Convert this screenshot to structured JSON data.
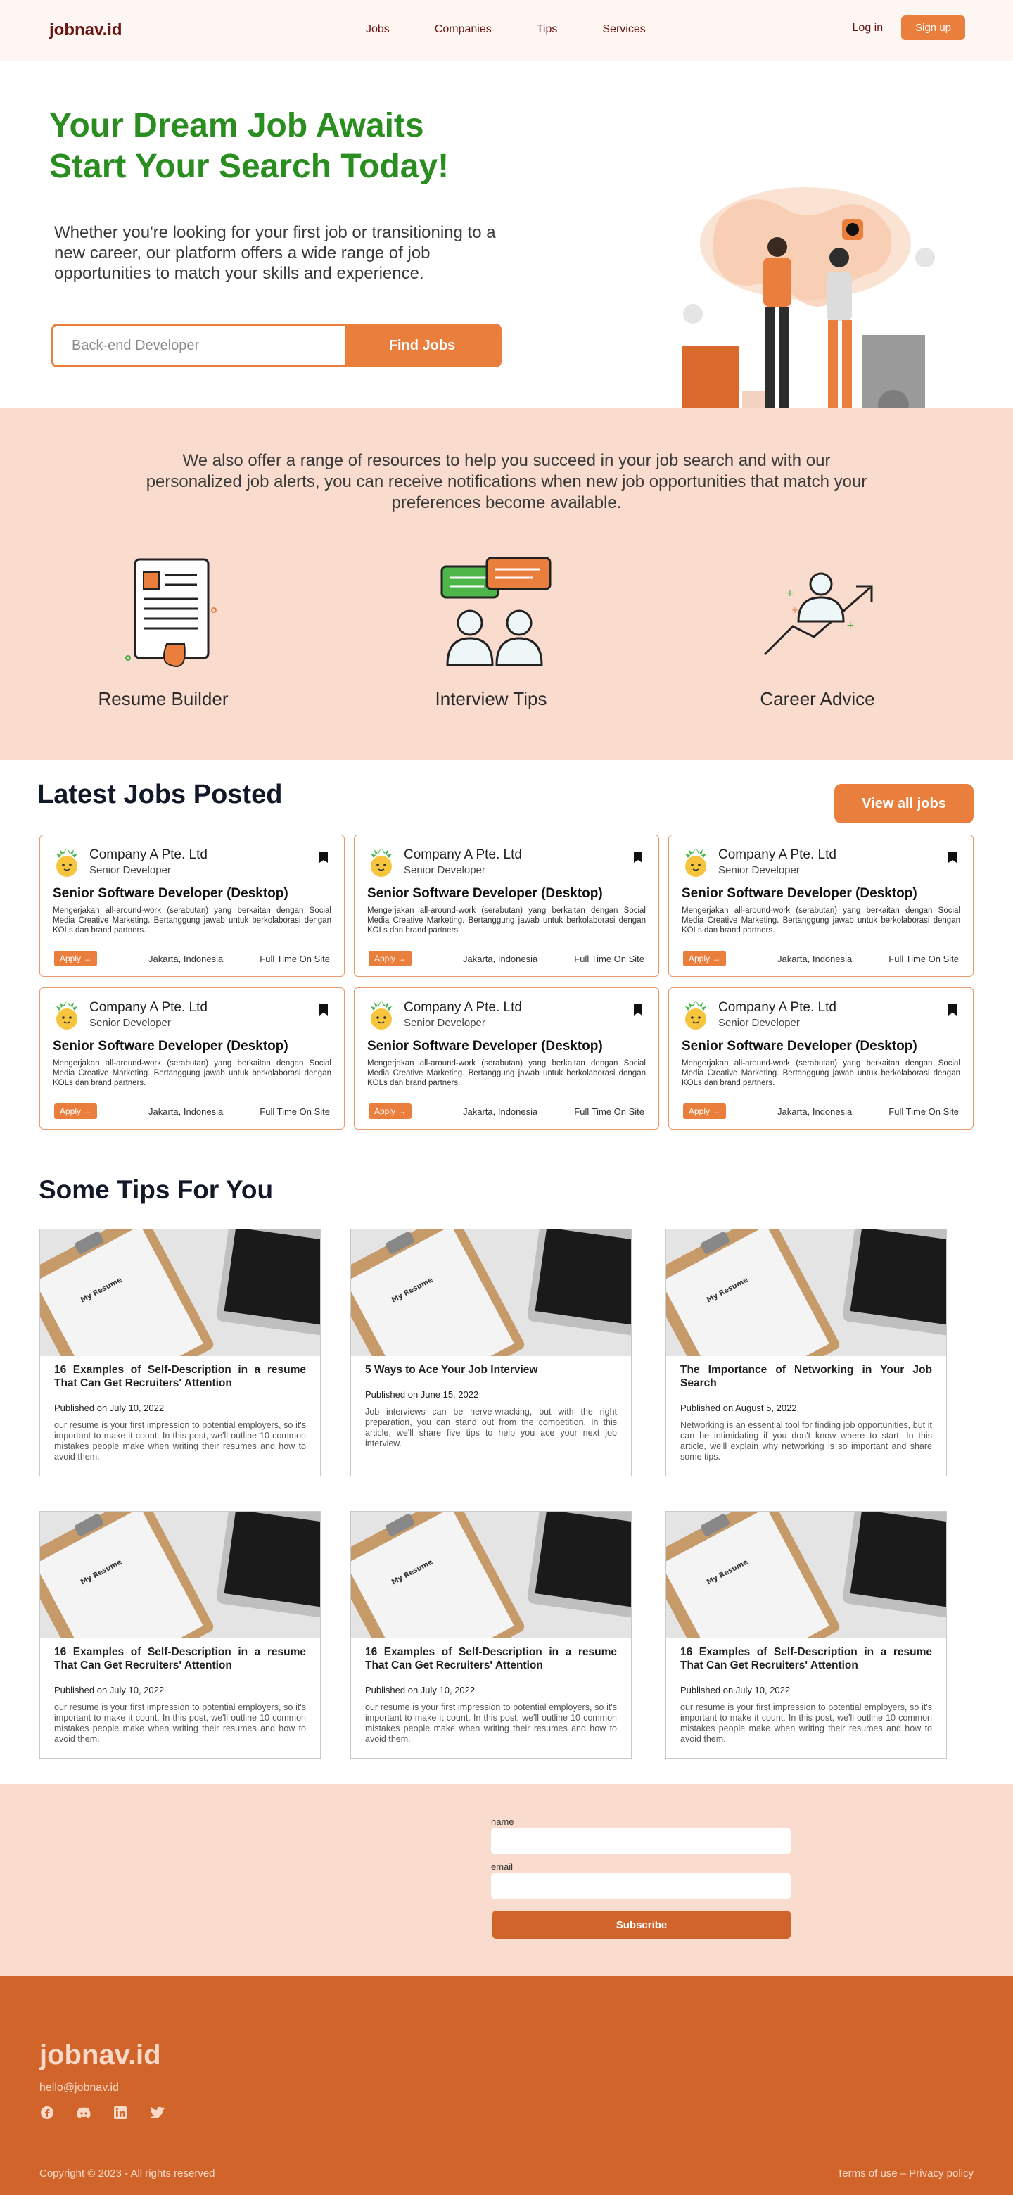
{
  "nav": {
    "brand": "jobnav.id",
    "links": [
      "Jobs",
      "Companies",
      "Tips",
      "Services"
    ],
    "login": "Log in",
    "signup": "Sign up"
  },
  "hero": {
    "title_line1": "Your Dream Job Awaits",
    "title_line2": "Start Your Search Today!",
    "subtitle": "Whether you're looking for your first job or transitioning to a new career, our platform offers a wide range of job opportunities to match your skills and experience.",
    "search_placeholder": "Back-end Developer",
    "search_button": "Find Jobs"
  },
  "resources": {
    "intro": "We also offer a range of resources to help you succeed in your job search and with our personalized job alerts, you can receive notifications when new job opportunities that match your preferences become available.",
    "items": [
      {
        "label": "Resume Builder",
        "icon": "resume-icon"
      },
      {
        "label": "Interview Tips",
        "icon": "interview-icon"
      },
      {
        "label": "Career Advice",
        "icon": "career-icon"
      }
    ]
  },
  "jobs": {
    "heading": "Latest Jobs Posted",
    "view_all": "View all jobs",
    "cards": [
      {
        "company": "Company A Pte. Ltd",
        "role": "Senior Developer",
        "title": "Senior Software Developer (Desktop)",
        "desc": "Mengerjakan all-around-work (serabutan) yang berkaitan dengan Social Media Creative Marketing. Bertanggung jawab untuk berkolaborasi dengan KOLs dan brand partners.",
        "apply": "Apply →",
        "location": "Jakarta, Indonesia",
        "type": "Full Time On Site"
      },
      {
        "company": "Company A Pte. Ltd",
        "role": "Senior Developer",
        "title": "Senior Software Developer (Desktop)",
        "desc": "Mengerjakan all-around-work (serabutan) yang berkaitan dengan Social Media Creative Marketing. Bertanggung jawab untuk berkolaborasi dengan KOLs dan brand partners.",
        "apply": "Apply →",
        "location": "Jakarta, Indonesia",
        "type": "Full Time On Site"
      },
      {
        "company": "Company A Pte. Ltd",
        "role": "Senior Developer",
        "title": "Senior Software Developer (Desktop)",
        "desc": "Mengerjakan all-around-work (serabutan) yang berkaitan dengan Social Media Creative Marketing. Bertanggung jawab untuk berkolaborasi dengan KOLs dan brand partners.",
        "apply": "Apply →",
        "location": "Jakarta, Indonesia",
        "type": "Full Time On Site"
      },
      {
        "company": "Company A Pte. Ltd",
        "role": "Senior Developer",
        "title": "Senior Software Developer (Desktop)",
        "desc": "Mengerjakan all-around-work (serabutan) yang berkaitan dengan Social Media Creative Marketing. Bertanggung jawab untuk berkolaborasi dengan KOLs dan brand partners.",
        "apply": "Apply →",
        "location": "Jakarta, Indonesia",
        "type": "Full Time On Site"
      },
      {
        "company": "Company A Pte. Ltd",
        "role": "Senior Developer",
        "title": "Senior Software Developer (Desktop)",
        "desc": "Mengerjakan all-around-work (serabutan) yang berkaitan dengan Social Media Creative Marketing. Bertanggung jawab untuk berkolaborasi dengan KOLs dan brand partners.",
        "apply": "Apply →",
        "location": "Jakarta, Indonesia",
        "type": "Full Time On Site"
      },
      {
        "company": "Company A Pte. Ltd",
        "role": "Senior Developer",
        "title": "Senior Software Developer (Desktop)",
        "desc": "Mengerjakan all-around-work (serabutan) yang berkaitan dengan Social Media Creative Marketing. Bertanggung jawab untuk berkolaborasi dengan KOLs dan brand partners.",
        "apply": "Apply →",
        "location": "Jakarta, Indonesia",
        "type": "Full Time On Site"
      }
    ]
  },
  "tips": {
    "heading": "Some Tips For You",
    "image_caption": "My Resume",
    "cards": [
      {
        "title": "16 Examples of Self-Description in a resume That Can Get Recruiters' Attention",
        "published": "Published on July 10, 2022",
        "excerpt": "our resume is your first impression to potential employers, so it's important to make it count. In this post, we'll outline 10 common mistakes people make when writing their resumes and how to avoid them."
      },
      {
        "title": "5 Ways to Ace Your Job Interview",
        "published": "Published on June 15, 2022",
        "excerpt": "Job interviews can be nerve-wracking, but with the right preparation, you can stand out from the competition. In this article, we'll share five tips to help you ace your next job interview."
      },
      {
        "title": "The Importance of Networking in Your Job Search",
        "published": "Published on August 5, 2022",
        "excerpt": "Networking is an essential tool for finding job opportunities, but it can be intimidating if you don't know where to start. In this article, we'll explain why networking is so important and share some tips."
      },
      {
        "title": "16 Examples of Self-Description in a resume That Can Get Recruiters' Attention",
        "published": "Published on July 10, 2022",
        "excerpt": "our resume is your first impression to potential employers, so it's important to make it count. In this post, we'll outline 10 common mistakes people make when writing their resumes and how to avoid them."
      },
      {
        "title": "16 Examples of Self-Description in a resume That Can Get Recruiters' Attention",
        "published": "Published on July 10, 2022",
        "excerpt": "our resume is your first impression to potential employers, so it's important to make it count. In this post, we'll outline 10 common mistakes people make when writing their resumes and how to avoid them."
      },
      {
        "title": "16 Examples of Self-Description in a resume That Can Get Recruiters' Attention",
        "published": "Published on July 10, 2022",
        "excerpt": "our resume is your first impression to potential employers, so it's important to make it count. In this post, we'll outline 10 common mistakes people make when writing their resumes and how to avoid them."
      }
    ]
  },
  "subscribe": {
    "name_label": "name",
    "email_label": "email",
    "button": "Subscribe"
  },
  "footer": {
    "brand": "jobnav.id",
    "email": "hello@jobnav.id",
    "socials": [
      "facebook-icon",
      "discord-icon",
      "linkedin-icon",
      "twitter-icon"
    ],
    "copyright": "Copyright © 2023 - All rights reserved",
    "legal": "Terms of use – Privacy policy"
  },
  "colors": {
    "accent": "#ea7e3c",
    "hero_title": "#2a8d1f",
    "section_bg": "#f9dccd",
    "footer_bg": "#d1642a"
  }
}
